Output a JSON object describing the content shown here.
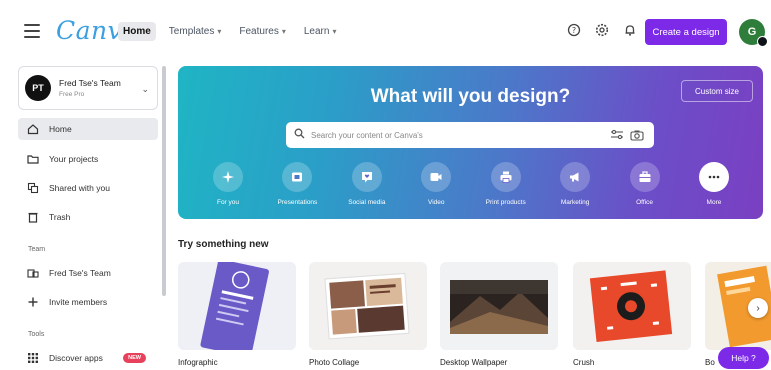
{
  "header": {
    "logo": "Canva",
    "nav": [
      {
        "label": "Home",
        "active": true,
        "dropdown": false
      },
      {
        "label": "Templates",
        "active": false,
        "dropdown": true
      },
      {
        "label": "Features",
        "active": false,
        "dropdown": true
      },
      {
        "label": "Learn",
        "active": false,
        "dropdown": true
      }
    ],
    "icons": [
      "help-icon",
      "settings-icon",
      "notifications-icon"
    ],
    "create_button": "Create a design",
    "avatar_initial": "G"
  },
  "sidebar": {
    "team": {
      "initials": "PT",
      "name": "Fred Tse's Team",
      "sub": "Free Pro"
    },
    "items": [
      {
        "label": "Home",
        "icon": "home-icon",
        "active": true
      },
      {
        "label": "Your projects",
        "icon": "folder-icon",
        "active": false
      },
      {
        "label": "Shared with you",
        "icon": "shared-icon",
        "active": false
      },
      {
        "label": "Trash",
        "icon": "trash-icon",
        "active": false
      }
    ],
    "section_team": "Team",
    "team_items": [
      {
        "label": "Fred Tse's Team",
        "icon": "team-icon"
      },
      {
        "label": "Invite members",
        "icon": "plus-icon"
      }
    ],
    "section_tools": "Tools",
    "tool_items": [
      {
        "label": "Discover apps",
        "icon": "apps-grid-icon",
        "badge": "NEW"
      }
    ]
  },
  "hero": {
    "title": "What will you design?",
    "custom_size": "Custom size",
    "search_placeholder": "Search your content or Canva's",
    "categories": [
      {
        "label": "For you",
        "icon": "sparkle-icon"
      },
      {
        "label": "Presentations",
        "icon": "presentation-icon"
      },
      {
        "label": "Social media",
        "icon": "heart-chat-icon"
      },
      {
        "label": "Video",
        "icon": "video-icon"
      },
      {
        "label": "Print products",
        "icon": "print-icon"
      },
      {
        "label": "Marketing",
        "icon": "megaphone-icon"
      },
      {
        "label": "Office",
        "icon": "briefcase-icon"
      },
      {
        "label": "More",
        "icon": "more-icon"
      }
    ]
  },
  "try_new": {
    "title": "Try something new",
    "cards": [
      {
        "label": "Infographic"
      },
      {
        "label": "Photo Collage"
      },
      {
        "label": "Desktop Wallpaper"
      },
      {
        "label": "Crush"
      },
      {
        "label": "Bo"
      }
    ]
  },
  "help": "Help ?"
}
